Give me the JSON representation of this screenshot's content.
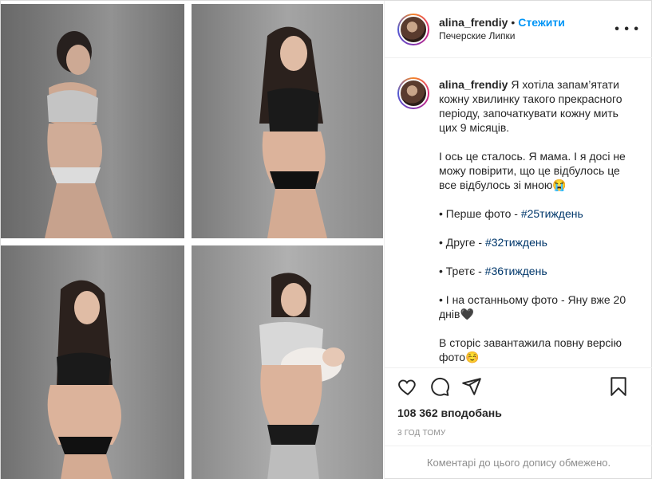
{
  "header": {
    "username": "alina_frendiy",
    "separator": "•",
    "follow_label": "Стежити",
    "location": "Печерские Липки",
    "more_icon": "more-horizontal-icon"
  },
  "photos": [
    {
      "alt": "photo-1"
    },
    {
      "alt": "photo-2"
    },
    {
      "alt": "photo-3"
    },
    {
      "alt": "photo-4"
    }
  ],
  "caption": {
    "username": "alina_frendiy",
    "p1": "Я хотіла запам’ятати кожну хвилинку такого прекрасного періоду, започаткувати кожну мить цих 9 місяців.\n\n",
    "p2": "І ось це сталось. Я мама. І я досі не можу повірити, що це відбулось це все відбулось зі мною😭\n\n",
    "item1_prefix": "• Перше фото - ",
    "item1_tag": "#25тиждень",
    "item2_prefix": "\n\n• Друге - ",
    "item2_tag": "#32тиждень",
    "item3_prefix": "\n\n• Третє - ",
    "item3_tag": "#36тиждень",
    "item4": "\n\n• І на останньому фото - Яну вже 20 днів🖤\n\n",
    "p_last": "В сторіс завантажила повну версію фото☺️"
  },
  "actions": {
    "like_icon": "heart-icon",
    "comment_icon": "comment-icon",
    "share_icon": "share-icon",
    "save_icon": "bookmark-icon",
    "likes_text": "108 362 вподобань",
    "time_text": "3 год тому"
  },
  "comments": {
    "restricted_text": "Коментарі до цього допису обмежено."
  },
  "colors": {
    "link": "#0095f6",
    "hashtag": "#00376b",
    "muted": "#8e8e8e"
  }
}
